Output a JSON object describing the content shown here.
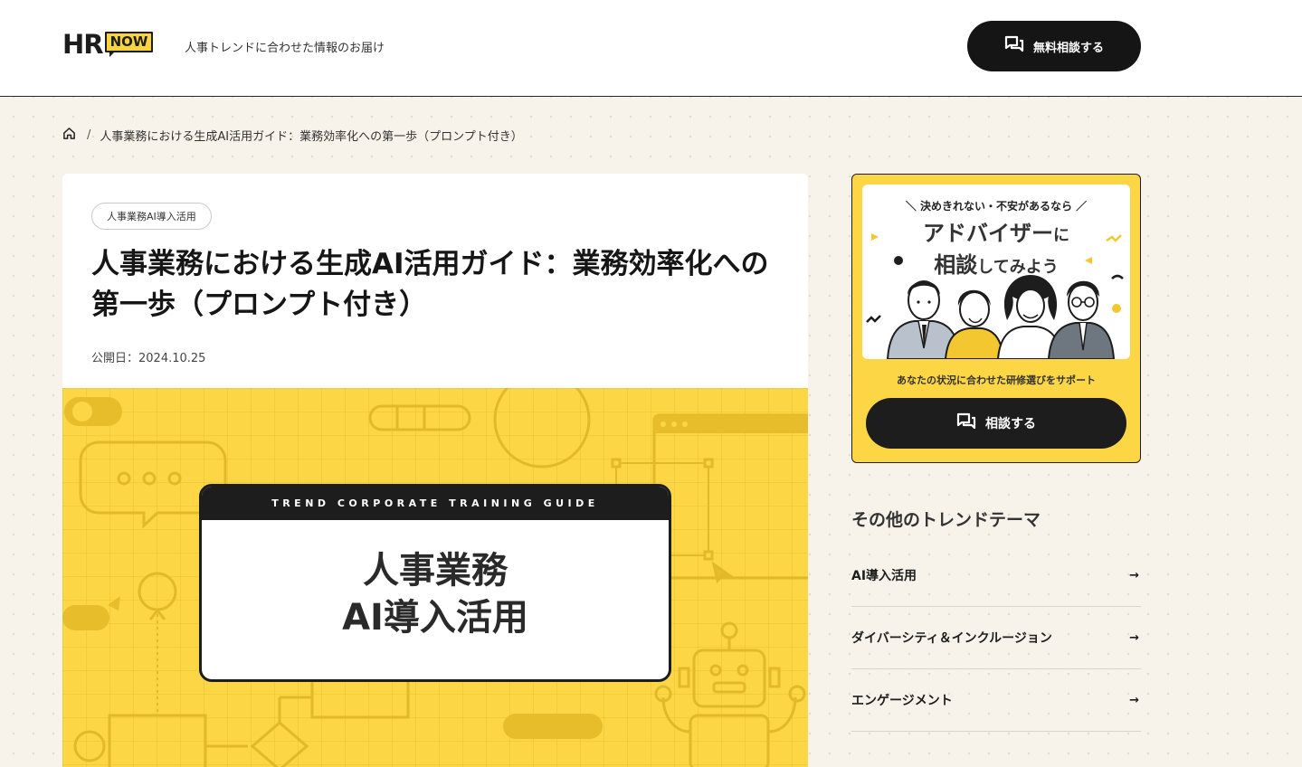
{
  "header": {
    "logo_hr": "HR",
    "logo_now": "NOW",
    "tagline": "人事トレンドに合わせた情報のお届け",
    "consult_button": "無料相談する"
  },
  "breadcrumb": {
    "separator": "/",
    "current": "人事業務における生成AI活用ガイド：業務効率化への第一歩（プロンプト付き）"
  },
  "article": {
    "tag": "人事業務AI導入活用",
    "title": "人事業務における生成AI活用ガイド：業務効率化への第一歩（プロンプト付き）",
    "published": "公開日：2024.10.25",
    "hero": {
      "band": "TREND CORPORATE TRAINING GUIDE",
      "line1": "人事業務",
      "line2": "AI導入活用"
    }
  },
  "advisor": {
    "lead": "＼ 決めきれない・不安があるなら ／",
    "heading_main": "アドバイザー",
    "heading_ni": "に",
    "heading_line2_a": "相談",
    "heading_line2_b": "してみよう",
    "sub": "あなたの状況に合わせた研修選びをサポート",
    "button": "相談する"
  },
  "other_themes": {
    "title": "その他のトレンドテーマ",
    "items": [
      {
        "label": "AI導入活用",
        "arrow": "→"
      },
      {
        "label": "ダイバーシティ＆インクルージョン",
        "arrow": "→"
      },
      {
        "label": "エンゲージメント",
        "arrow": "→"
      }
    ]
  },
  "colors": {
    "accent_yellow": "#fdd645",
    "dark": "#1d1d1d",
    "page_bg": "#f7f3ea"
  }
}
